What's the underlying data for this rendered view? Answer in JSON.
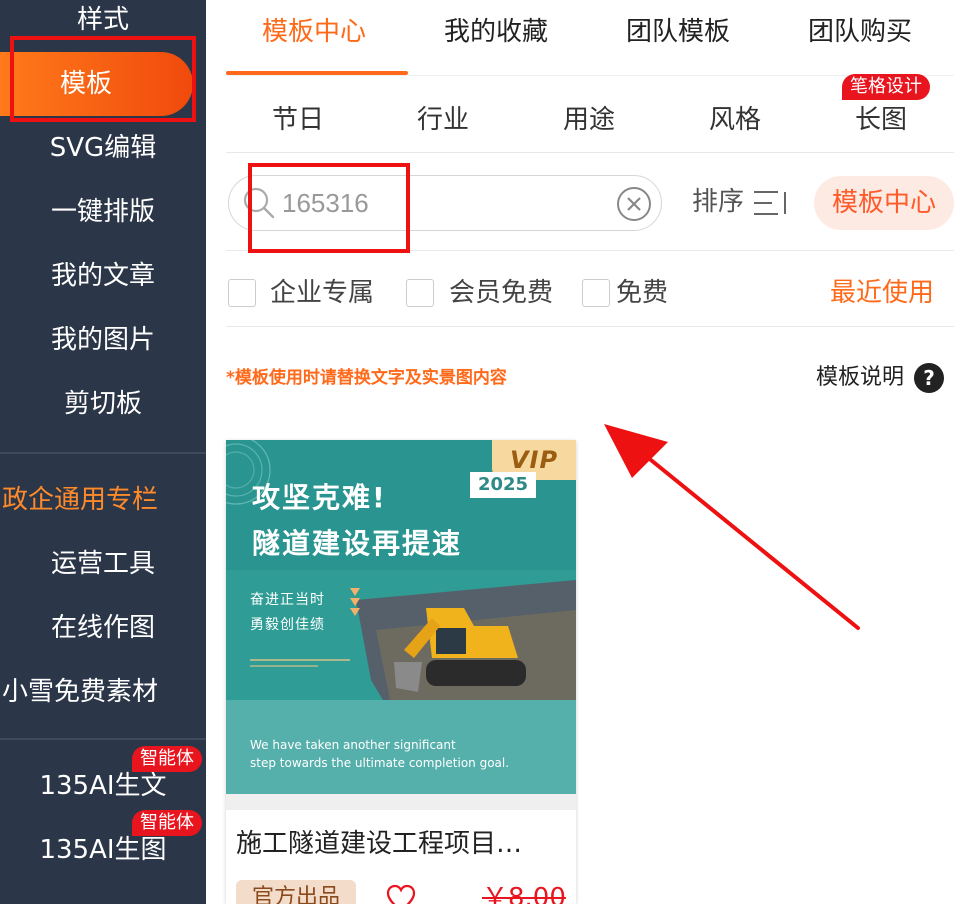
{
  "sidebar": {
    "items": [
      {
        "label": "样式"
      },
      {
        "label": "模板",
        "active": true
      },
      {
        "label": "SVG编辑"
      },
      {
        "label": "一键排版"
      },
      {
        "label": "我的文章"
      },
      {
        "label": "我的图片"
      },
      {
        "label": "剪切板"
      },
      {
        "label": "政企通用专栏",
        "highlight": true
      },
      {
        "label": "运营工具"
      },
      {
        "label": "在线作图"
      },
      {
        "label": "小雪免费素材"
      },
      {
        "label": "135AI生文",
        "badge": "智能体"
      },
      {
        "label": "135AI生图",
        "badge": "智能体"
      }
    ]
  },
  "tabs": [
    {
      "label": "模板中心",
      "active": true
    },
    {
      "label": "我的收藏"
    },
    {
      "label": "团队模板"
    },
    {
      "label": "团队购买"
    }
  ],
  "categories": [
    {
      "label": "节日"
    },
    {
      "label": "行业"
    },
    {
      "label": "用途"
    },
    {
      "label": "风格"
    },
    {
      "label": "长图",
      "badge": "笔格设计"
    }
  ],
  "search": {
    "value": "165316"
  },
  "sort": {
    "label": "排序",
    "icon": "sort-icon"
  },
  "source_pill": "模板中心",
  "filters": [
    {
      "label": "企业专属",
      "checked": false
    },
    {
      "label": "会员免费",
      "checked": false
    },
    {
      "label": "免费",
      "checked": false
    }
  ],
  "recent_label": "最近使用",
  "notice": "*模板使用时请替换文字及实景图内容",
  "explain_label": "模板说明",
  "help_glyph": "?",
  "card": {
    "vip": "VIP",
    "year": "2025",
    "headline_1": "攻坚克难!",
    "headline_2": "隧道建设再提速",
    "sub_1": "奋进正当时",
    "sub_2": "勇毅创佳绩",
    "en_1": "We have taken another significant",
    "en_2": "step towards the ultimate completion goal.",
    "title": "施工隧道建设工程项目…",
    "official": "官方出品",
    "price": "￥8.00"
  },
  "colors": {
    "accent": "#ff6a1a",
    "sidebar_bg": "#2b3648",
    "badge_red": "#e8151f",
    "teal": "#2e9a95",
    "annotation_red": "#ee1111"
  }
}
